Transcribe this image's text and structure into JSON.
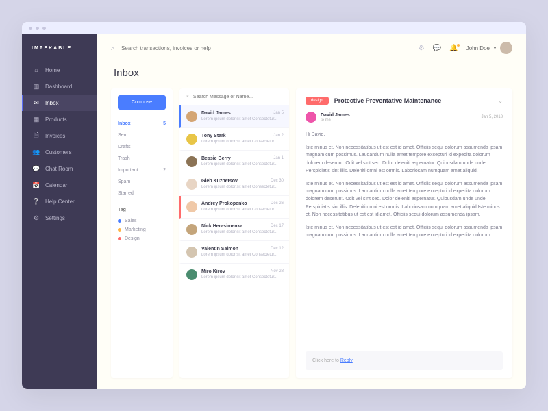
{
  "brand": "IMPEKABLE",
  "search": {
    "placeholder": "Search transactions, invoices or help"
  },
  "user": {
    "name": "John Doe"
  },
  "nav": [
    {
      "icon": "home",
      "label": "Home"
    },
    {
      "icon": "bars",
      "label": "Dashboard"
    },
    {
      "icon": "mail",
      "label": "Inbox",
      "active": true
    },
    {
      "icon": "grid",
      "label": "Products"
    },
    {
      "icon": "doc",
      "label": "Invoices"
    },
    {
      "icon": "users",
      "label": "Customers"
    },
    {
      "icon": "chat",
      "label": "Chat Room"
    },
    {
      "icon": "cal",
      "label": "Calendar"
    },
    {
      "icon": "help",
      "label": "Help Center"
    },
    {
      "icon": "gear",
      "label": "Settings"
    }
  ],
  "pageTitle": "Inbox",
  "compose": "Compose",
  "folders": [
    {
      "name": "Inbox",
      "count": "5",
      "active": true
    },
    {
      "name": "Sent"
    },
    {
      "name": "Drafts"
    },
    {
      "name": "Trash"
    },
    {
      "name": "Important",
      "count": "2"
    },
    {
      "name": "Spam"
    },
    {
      "name": "Starred"
    }
  ],
  "tagHeader": "Tag",
  "tags": [
    {
      "name": "Sales",
      "color": "#4a7dff"
    },
    {
      "name": "Marketing",
      "color": "#ffb648"
    },
    {
      "name": "Design",
      "color": "#ff6b6b"
    }
  ],
  "msgSearch": {
    "placeholder": "Search Message or Name..."
  },
  "messages": [
    {
      "name": "David James",
      "preview": "Lorem ipsum dolor sit amet Consectetur...",
      "date": "Jan 5",
      "color": "#d4a574",
      "sel": true
    },
    {
      "name": "Tony Stark",
      "preview": "Lorem ipsum dolor sit amet Consectetur...",
      "date": "Jan 2",
      "color": "#e8c547"
    },
    {
      "name": "Bessie Berry",
      "preview": "Lorem ipsum dolor sit amet Consectetur...",
      "date": "Jan 1",
      "color": "#8b7355"
    },
    {
      "name": "Gleb Kuznetsov",
      "preview": "Lorem ipsum dolor sit amet Consectetur...",
      "date": "Dec 30",
      "color": "#e8d5c4"
    },
    {
      "name": "Andrey Prokopenko",
      "preview": "Lorem ipsum dolor sit amet Consectetur...",
      "date": "Dec 26",
      "color": "#f0c9a8",
      "accent": "red"
    },
    {
      "name": "Nick Herasimenka",
      "preview": "Lorem ipsum dolor sit amet Consectetur...",
      "date": "Dec 17",
      "color": "#c4a57b"
    },
    {
      "name": "Valentin Salmon",
      "preview": "Lorem ipsum dolor sit amet Consectetur...",
      "date": "Dec 12",
      "color": "#d4c5b0"
    },
    {
      "name": "Miro Kirov",
      "preview": "Lorem ipsum dolor sit amet Consectetur...",
      "date": "Nov 28",
      "color": "#4a8c6f"
    }
  ],
  "reader": {
    "badge": "design",
    "subject": "Protective Preventative Maintenance",
    "from": "David James",
    "to": "to me",
    "date": "Jan 5, 2018",
    "greeting": "Hi David,",
    "p1": "Iste minus et. Non necessitatibus ut est est id amet. Officiis sequi dolorum assumenda ipsam magnam cum possimus. Laudantium nulla amet tempore excepturi id expedita dolorum dolorem deserunt. Odit vel sint sed. Dolor deleniti aspernatur. Quibusdam unde unde. Perspiciatis sint illis. Deleniti omni est omnis. Laboriosam numquam amet aliquid.",
    "p2": "Iste minus et. Non necessitatibus ut est est id amet. Officiis sequi dolorum assumenda ipsam magnam cum possimus. Laudantium nulla amet tempore excepturi id expedita dolorum dolorem deserunt. Odit vel sint sed. Dolor deleniti aspernatur. Quibusdam unde unde. Perspiciatis sint illis. Deleniti omni est omnis. Laboriosam numquam amet aliquid.Iste minus et. Non necessitatibus ut est est id amet. Officiis sequi dolorum assumenda ipsam.",
    "p3": "Iste minus et. Non necessitatibus ut est est id amet. Officiis sequi dolorum assumenda ipsam magnam cum possimus. Laudantium nulla amet tempore excepturi id expedita dolorum",
    "replyPrompt": "Click here to ",
    "replyLink": "Reply"
  }
}
